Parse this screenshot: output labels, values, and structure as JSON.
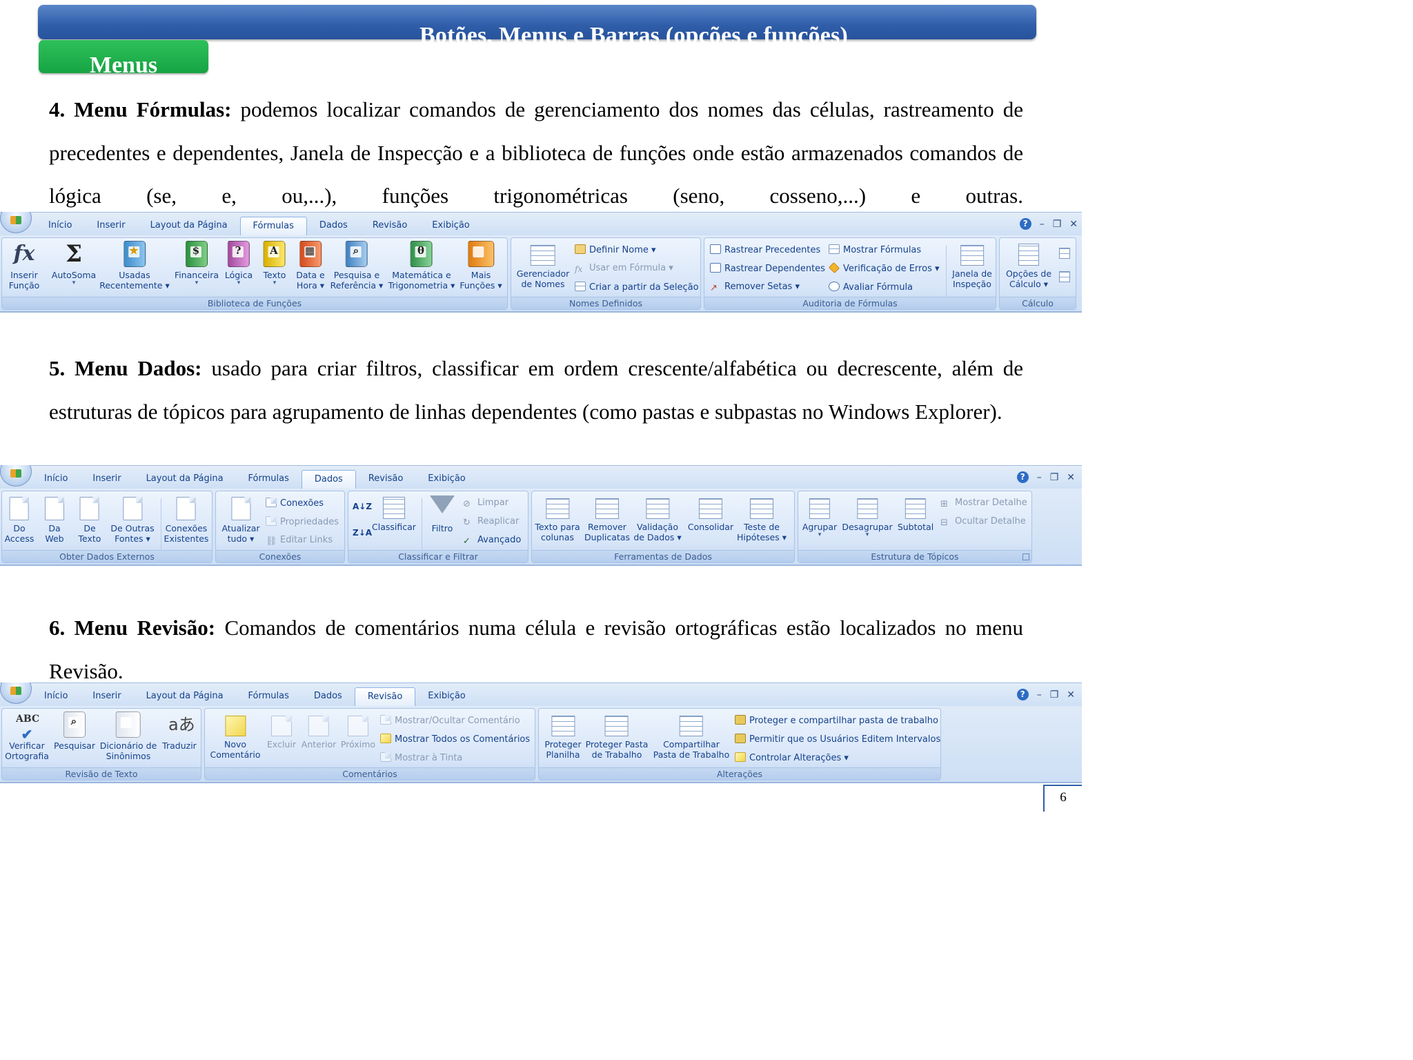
{
  "slide": {
    "title": "Botões,  Menus e Barras (opções e funções)",
    "section": "Menus",
    "page_number": "6"
  },
  "paragraphs": {
    "p4_heading": "4. Menu Fórmulas:",
    "p4_text": "podemos localizar comandos de gerenciamento dos nomes das células, rastreamento de precedentes e dependentes, Janela de Inspecção e a biblioteca de funções onde estão armazenados comandos de lógica (se, e, ou,...), funções trigonométricas (seno, cosseno,...) e outras.",
    "p5_heading": "5. Menu Dados:",
    "p5_text": "usado para criar filtros, classificar em ordem crescente/alfabética ou decrescente, além de estruturas de tópicos para agrupamento de linhas dependentes (como pastas e subpastas no Windows Explorer).",
    "p6_heading": "6. Menu Revisão:",
    "p6_text": "Comandos de comentários numa célula e revisão ortográficas estão localizados no menu Revisão."
  },
  "ribbon_formulas": {
    "tabs": [
      "Início",
      "Inserir",
      "Layout da Página",
      "Fórmulas",
      "Dados",
      "Revisão",
      "Exibição"
    ],
    "active_tab": "Fórmulas",
    "groups": {
      "biblioteca": "Biblioteca de Funções",
      "nomes": "Nomes Definidos",
      "auditoria": "Auditoria de Fórmulas",
      "calculo": "Cálculo"
    },
    "buttons": {
      "inserir_funcao": [
        "Inserir",
        "Função"
      ],
      "autosoma": "AutoSoma",
      "usadas": "Usadas",
      "recentemente": "Recentemente",
      "financeira": "Financeira",
      "logica": "Lógica",
      "texto": "Texto",
      "data_hora": [
        "Data e",
        "Hora"
      ],
      "pesquisa": [
        "Pesquisa e",
        "Referência"
      ],
      "matematica": [
        "Matemática e",
        "Trigonometria"
      ],
      "mais_funcoes": [
        "Mais",
        "Funções"
      ],
      "gerenciador": [
        "Gerenciador",
        "de Nomes"
      ],
      "definir_nome": "Definir Nome",
      "usar_formula": "Usar em Fórmula",
      "criar_selecao": "Criar a partir da Seleção",
      "rastrear_prec": "Rastrear Precedentes",
      "rastrear_dep": "Rastrear Dependentes",
      "remover_setas": "Remover Setas",
      "mostrar_formulas": "Mostrar Fórmulas",
      "verificacao_erros": "Verificação de Erros",
      "avaliar_formula": "Avaliar Fórmula",
      "janela_inspecao": [
        "Janela de",
        "Inspeção"
      ],
      "opcoes_calculo": [
        "Opções de",
        "Cálculo"
      ]
    },
    "icons": {
      "library_letters": {
        "logica": "?",
        "texto": "A",
        "matematica": "θ"
      }
    }
  },
  "ribbon_dados": {
    "tabs": [
      "Início",
      "Inserir",
      "Layout da Página",
      "Fórmulas",
      "Dados",
      "Revisão",
      "Exibição"
    ],
    "active_tab": "Dados",
    "groups": {
      "externos": "Obter Dados Externos",
      "conexoes": "Conexões",
      "classificar": "Classificar e Filtrar",
      "ferramentas": "Ferramentas de Dados",
      "estrutura": "Estrutura de Tópicos"
    },
    "buttons": {
      "do_access": [
        "Do",
        "Access"
      ],
      "da_web": [
        "Da",
        "Web"
      ],
      "de_texto": [
        "De",
        "Texto"
      ],
      "outras_fontes": [
        "De Outras",
        "Fontes"
      ],
      "conexoes_exist": [
        "Conexões",
        "Existentes"
      ],
      "atualizar": [
        "Atualizar",
        "tudo"
      ],
      "conexoes": "Conexões",
      "propriedades": "Propriedades",
      "editar_links": "Editar Links",
      "az": "A↓Z",
      "za": "Z↓A",
      "classificar": "Classificar",
      "filtro": "Filtro",
      "limpar": "Limpar",
      "reaplicar": "Reaplicar",
      "avancado": "Avançado",
      "texto_colunas": [
        "Texto para",
        "colunas"
      ],
      "remover_dup": [
        "Remover",
        "Duplicatas"
      ],
      "validacao": [
        "Validação",
        "de Dados"
      ],
      "consolidar": "Consolidar",
      "teste_hip": [
        "Teste de",
        "Hipóteses"
      ],
      "agrupar": "Agrupar",
      "desagrupar": "Desagrupar",
      "subtotal": "Subtotal",
      "mostrar_detalhe": "Mostrar Detalhe",
      "ocultar_detalhe": "Ocultar Detalhe"
    }
  },
  "ribbon_revisao": {
    "tabs": [
      "Início",
      "Inserir",
      "Layout da Página",
      "Fórmulas",
      "Dados",
      "Revisão",
      "Exibição"
    ],
    "active_tab": "Revisão",
    "groups": {
      "revisao_texto": "Revisão de Texto",
      "comentarios": "Comentários",
      "alteracoes": "Alterações"
    },
    "buttons": {
      "verificar": [
        "Verificar",
        "Ortografia"
      ],
      "pesquisar": "Pesquisar",
      "dicionario": [
        "Dicionário de",
        "Sinônimos"
      ],
      "traduzir": "Traduzir",
      "novo_coment": [
        "Novo",
        "Comentário"
      ],
      "excluir": "Excluir",
      "anterior": "Anterior",
      "proximo": "Próximo",
      "mostrar_ocultar": "Mostrar/Ocultar Comentário",
      "mostrar_todos": "Mostrar Todos os Comentários",
      "mostrar_tinta": "Mostrar à Tinta",
      "proteger_planilha": [
        "Proteger",
        "Planilha"
      ],
      "proteger_pasta": [
        "Proteger Pasta",
        "de Trabalho"
      ],
      "compartilhar": [
        "Compartilhar",
        "Pasta de Trabalho"
      ],
      "proteger_compart": "Proteger e compartilhar pasta de trabalho",
      "permitir_usuarios": "Permitir que os Usuários Editem Intervalos",
      "controlar": "Controlar Alterações"
    },
    "icons": {
      "abc": "ABC",
      "translate": "aあ"
    }
  },
  "window_controls": {
    "help": "?",
    "minimize": "–",
    "restore": "❐",
    "close": "✕"
  },
  "colors": {
    "title_bar": "#2f5da8",
    "section_tab": "#16a443",
    "ribbon_text": "#15428b",
    "ribbon_bg": "#dfeaf8"
  }
}
